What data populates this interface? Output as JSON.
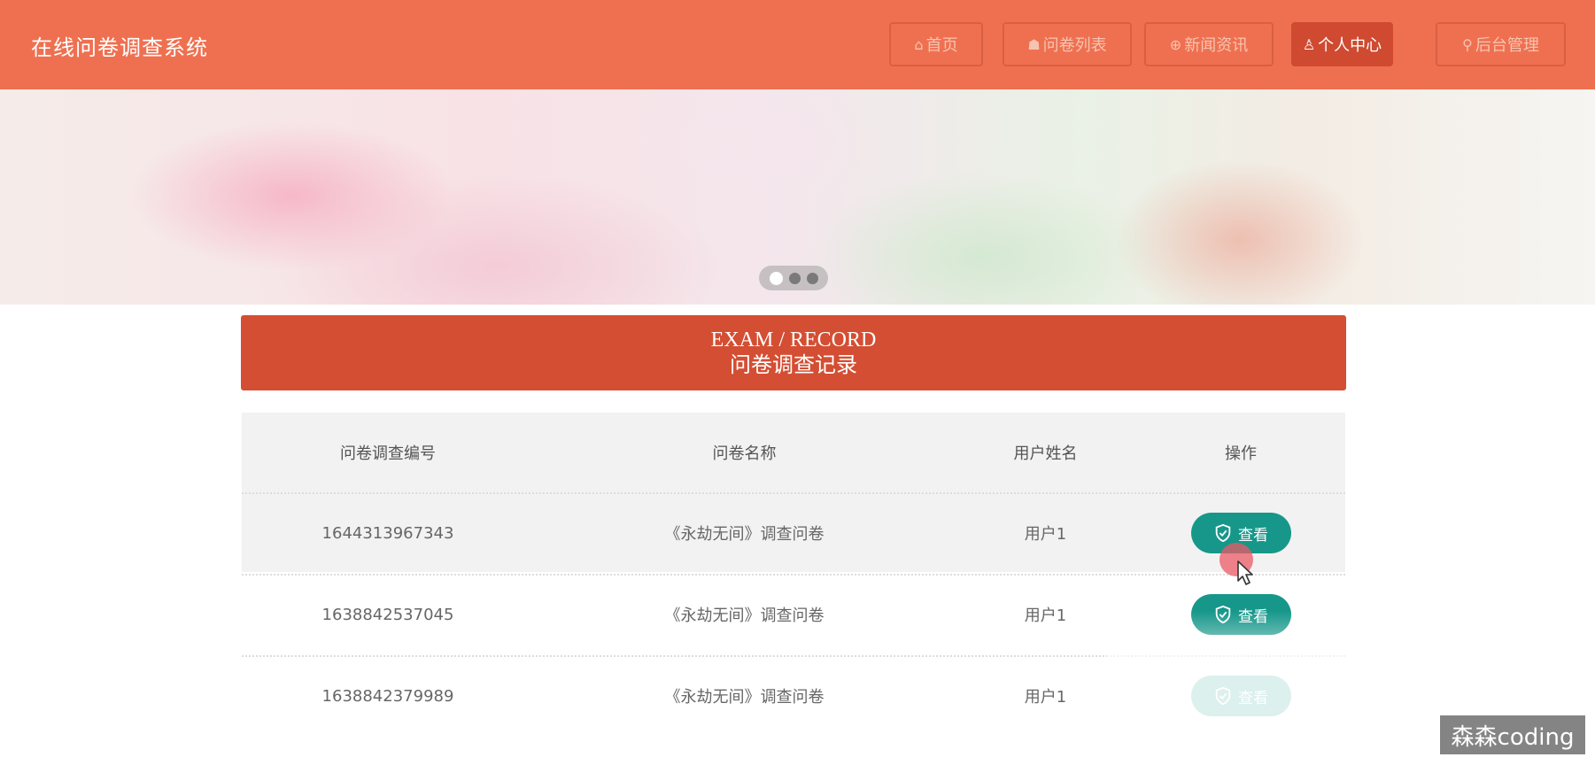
{
  "header": {
    "site_title": "在线问卷调查系统",
    "nav": [
      {
        "label": "首页",
        "icon": "home-icon",
        "glyph": "⌂",
        "active": false
      },
      {
        "label": "问卷列表",
        "icon": "graduation-cap-icon",
        "glyph": "☗",
        "active": false
      },
      {
        "label": "新闻资讯",
        "icon": "globe-icon",
        "glyph": "⊕",
        "active": false
      },
      {
        "label": "个人中心",
        "icon": "user-icon",
        "glyph": "♙",
        "active": true
      },
      {
        "label": "后台管理",
        "icon": "link-icon",
        "glyph": "⚲",
        "active": false
      }
    ],
    "background_color": "#ef7050",
    "active_nav_color": "#cf4a30"
  },
  "banner": {
    "slide_count": 3,
    "active_slide": 1
  },
  "section": {
    "title_en": "EXAM / RECORD",
    "title_cn": "问卷调查记录",
    "background_color": "#d44e33"
  },
  "table": {
    "headers": [
      "问卷调查编号",
      "问卷名称",
      "用户姓名",
      "操作"
    ],
    "rows": [
      {
        "id": "1644313967343",
        "name": "《永劫无间》调查问卷",
        "user": "用户1",
        "action": "查看"
      },
      {
        "id": "1638842537045",
        "name": "《永劫无间》调查问卷",
        "user": "用户1",
        "action": "查看"
      },
      {
        "id": "1638842379989",
        "name": "《永劫无间》调查问卷",
        "user": "用户1",
        "action": "查看"
      }
    ],
    "action_color": "#16978a",
    "action_icon": "shield-check-icon"
  },
  "watermark": "森森coding"
}
